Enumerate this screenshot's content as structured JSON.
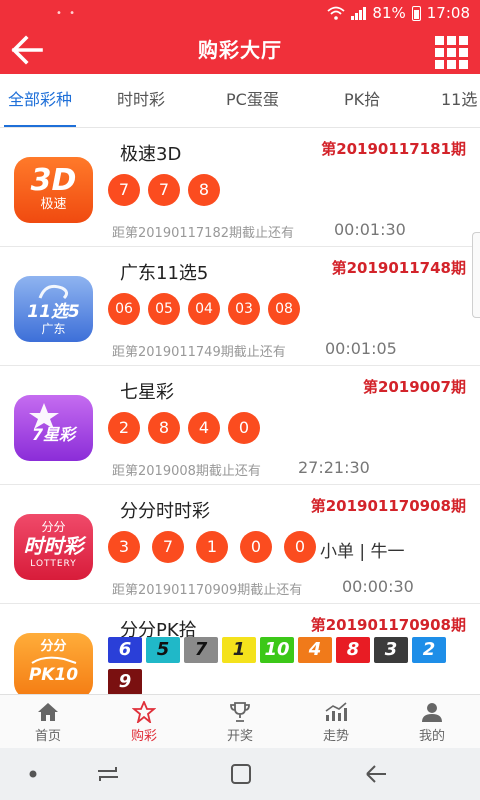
{
  "status_bar": {
    "battery": "81%",
    "time": "17:08"
  },
  "header": {
    "title": "购彩大厅"
  },
  "tabs": [
    "全部彩种",
    "时时彩",
    "PC蛋蛋",
    "PK拾",
    "11选"
  ],
  "lotteries": [
    {
      "logo_text": "3D",
      "logo_sub": "极速",
      "name": "极速3D",
      "issue": "第20190117181期",
      "balls": [
        "7",
        "7",
        "8"
      ],
      "deadline": "距第20190117182期截止还有",
      "countdown": "00:01:30"
    },
    {
      "logo_text": "11选5",
      "logo_sub": "广东",
      "name": "广东11选5",
      "issue": "第2019011748期",
      "balls": [
        "06",
        "05",
        "04",
        "03",
        "08"
      ],
      "deadline": "距第2019011749期截止还有",
      "countdown": "00:01:05"
    },
    {
      "logo_text": "7星彩",
      "name": "七星彩",
      "issue": "第2019007期",
      "balls": [
        "2",
        "8",
        "4",
        "0"
      ],
      "deadline": "距第2019008期截止还有",
      "countdown": "27:21:30"
    },
    {
      "logo_text": "时时彩",
      "logo_top": "分分",
      "logo_sub": "LOTTERY",
      "name": "分分时时彩",
      "issue": "第201901170908期",
      "balls": [
        "3",
        "7",
        "1",
        "0",
        "0"
      ],
      "extra": "小单 | 牛一",
      "deadline": "距第201901170909期截止还有",
      "countdown": "00:00:30"
    },
    {
      "logo_text": "PK10",
      "logo_top": "分分",
      "name": "分分PK拾",
      "issue": "第201901170908期",
      "pk_balls": [
        {
          "n": "6",
          "color": "#2a3fd8"
        },
        {
          "n": "5",
          "color": "#20b8c8"
        },
        {
          "n": "7",
          "color": "#8a8a8a"
        },
        {
          "n": "1",
          "color": "#f4e21c"
        },
        {
          "n": "10",
          "color": "#3cc818"
        },
        {
          "n": "4",
          "color": "#f07a1a"
        },
        {
          "n": "8",
          "color": "#e81c24"
        },
        {
          "n": "3",
          "color": "#3b3b3b"
        },
        {
          "n": "2",
          "color": "#1e8ee8"
        },
        {
          "n": "9",
          "color": "#7a1010"
        }
      ]
    }
  ],
  "bottom_nav": [
    "首页",
    "购彩",
    "开奖",
    "走势",
    "我的"
  ],
  "colors": {
    "brand": "#f0303a",
    "ball": "#fb4c1f",
    "tab_active": "#1e6fd8"
  },
  "icons": [
    "wifi-icon",
    "signal-icon",
    "battery-icon",
    "back-arrow-icon",
    "grid-menu-icon",
    "home-icon",
    "lottery-star-icon",
    "trophy-icon",
    "trend-chart-icon",
    "user-icon"
  ]
}
